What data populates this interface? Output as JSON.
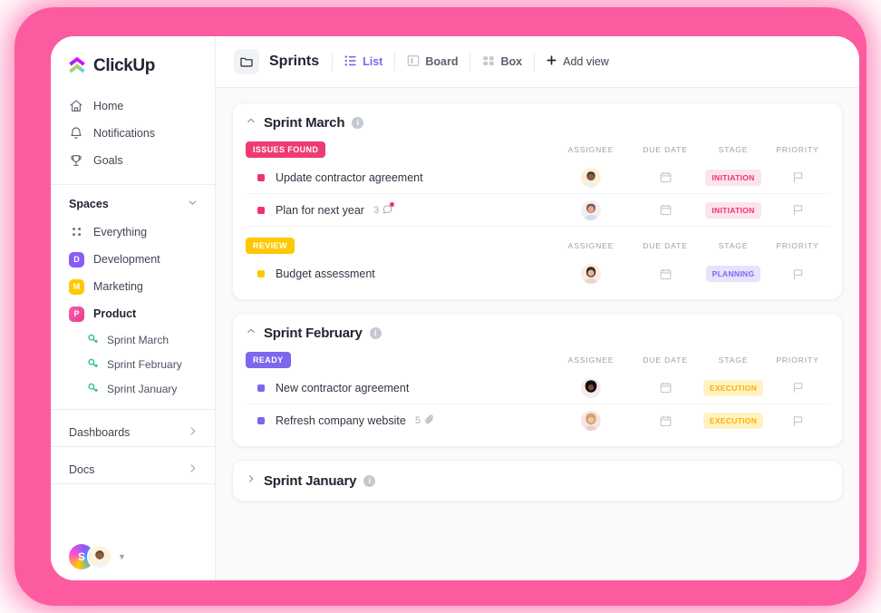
{
  "brand": {
    "name": "ClickUp",
    "logo_icon": "clickup-logo-icon",
    "accent": "#7B68EE",
    "frame_color": "#FD5BA0"
  },
  "sidebar": {
    "nav": [
      {
        "label": "Home",
        "icon": "home-icon"
      },
      {
        "label": "Notifications",
        "icon": "bell-icon"
      },
      {
        "label": "Goals",
        "icon": "trophy-icon"
      }
    ],
    "spaces_header": {
      "label": "Spaces",
      "icon": "chevron-down-icon"
    },
    "everything": {
      "label": "Everything",
      "icon": "grid-dots-icon"
    },
    "spaces": [
      {
        "label": "Development",
        "initial": "D",
        "color": "#8A5CF6",
        "active": false
      },
      {
        "label": "Marketing",
        "initial": "M",
        "color": "#FFC800",
        "active": false
      },
      {
        "label": "Product",
        "initial": "P",
        "color": "#F museum",
        "active": true
      }
    ],
    "lists": [
      {
        "label": "Sprint  March",
        "icon": "list-sprint-icon"
      },
      {
        "label": "Sprint  February",
        "icon": "list-sprint-icon"
      },
      {
        "label": "Sprint January",
        "icon": "list-sprint-icon"
      }
    ],
    "footer_rows": [
      {
        "label": "Dashboards",
        "icon": "chevron-right-icon"
      },
      {
        "label": "Docs",
        "icon": "chevron-right-icon"
      }
    ],
    "bottom_avatars": [
      {
        "name": "workspace-avatar",
        "initial": "S",
        "type": "gradient"
      },
      {
        "name": "user-avatar",
        "initial": "",
        "type": "photo"
      }
    ],
    "bottom_caret": "chevron-down-icon"
  },
  "topbar": {
    "folder_icon": "folder-icon",
    "title": "Sprints",
    "tabs": [
      {
        "label": "List",
        "icon": "list-view-icon",
        "active": true
      },
      {
        "label": "Board",
        "icon": "board-view-icon",
        "active": false
      },
      {
        "label": "Box",
        "icon": "box-view-icon",
        "active": false
      }
    ],
    "add_view": {
      "label": "Add view",
      "icon": "plus-icon"
    }
  },
  "columns": [
    "ASSIGNEE",
    "DUE DATE",
    "STAGE",
    "PRIORITY"
  ],
  "sprints": [
    {
      "title": "Sprint March",
      "collapsed": false,
      "info_icon": "info-icon",
      "collapse_icon": "chevron-up-icon",
      "groups": [
        {
          "status": "ISSUES FOUND",
          "status_bg": "#EE3B72",
          "status_fg": "#FFFFFF",
          "tasks": [
            {
              "name": "Update contractor agreement",
              "dot": "#F0336B",
              "meta_count": "",
              "meta_icon": "",
              "assignee": "assignee-avatar",
              "due_date_icon": "calendar-icon",
              "stage": "INITIATION",
              "stage_bg": "#FCE4EC",
              "stage_fg": "#F0336B",
              "priority_icon": "flag-icon"
            },
            {
              "name": "Plan for next year",
              "dot": "#F0336B",
              "meta_count": "3",
              "meta_icon": "comment-icon",
              "assignee": "assignee-avatar",
              "due_date_icon": "calendar-icon",
              "stage": "INITIATION",
              "stage_bg": "#FCE4EC",
              "stage_fg": "#F0336B",
              "priority_icon": "flag-icon"
            }
          ]
        },
        {
          "status": "REVIEW",
          "status_bg": "#FFC800",
          "status_fg": "#FFFFFF",
          "tasks": [
            {
              "name": "Budget assessment",
              "dot": "#FFC800",
              "meta_count": "",
              "meta_icon": "",
              "assignee": "assignee-avatar",
              "due_date_icon": "calendar-icon",
              "stage": "PLANNING",
              "stage_bg": "#E6E3FB",
              "stage_fg": "#7B68EE",
              "priority_icon": "flag-icon"
            }
          ]
        }
      ]
    },
    {
      "title": "Sprint February",
      "collapsed": false,
      "info_icon": "info-icon",
      "collapse_icon": "chevron-up-icon",
      "groups": [
        {
          "status": "READY",
          "status_bg": "#7B68EE",
          "status_fg": "#FFFFFF",
          "tasks": [
            {
              "name": "New contractor agreement",
              "dot": "#7B68EE",
              "meta_count": "",
              "meta_icon": "",
              "assignee": "assignee-avatar",
              "due_date_icon": "calendar-icon",
              "stage": "EXECUTION",
              "stage_bg": "#FFF3C4",
              "stage_fg": "#FFAE00",
              "priority_icon": "flag-icon"
            },
            {
              "name": "Refresh company website",
              "dot": "#7B68EE",
              "meta_count": "5",
              "meta_icon": "attachment-icon",
              "assignee": "assignee-avatar",
              "due_date_icon": "calendar-icon",
              "stage": "EXECUTION",
              "stage_bg": "#FFF3C4",
              "stage_fg": "#FFAE00",
              "priority_icon": "flag-icon"
            }
          ]
        }
      ]
    },
    {
      "title": "Sprint January",
      "collapsed": true,
      "info_icon": "info-icon",
      "collapse_icon": "chevron-right-icon",
      "groups": []
    }
  ]
}
